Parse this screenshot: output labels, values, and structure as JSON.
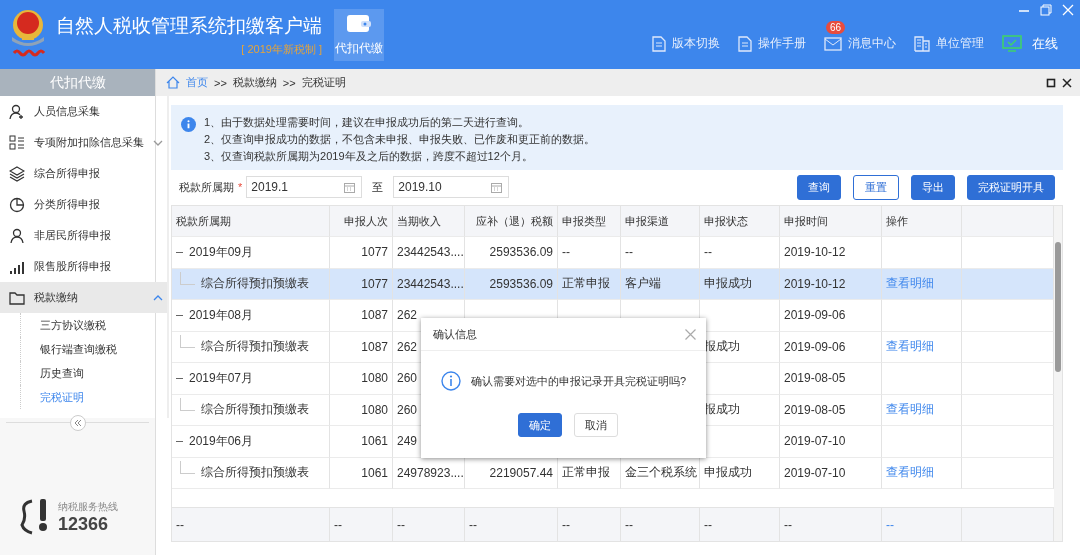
{
  "header": {
    "title": "自然人税收管理系统扣缴客户端",
    "subtitle": "[ 2019年新税制 ]",
    "module": {
      "label": "代扣代缴",
      "selected": true
    },
    "nav": [
      {
        "kind": "doc",
        "label": "版本切换"
      },
      {
        "kind": "doc",
        "label": "操作手册"
      },
      {
        "kind": "mail",
        "label": "消息中心",
        "badge": "66"
      },
      {
        "kind": "building",
        "label": "单位管理"
      },
      {
        "kind": "online",
        "label": "在线"
      }
    ]
  },
  "sidebar": {
    "title": "代扣代缴",
    "items": [
      {
        "kind": "person-plus",
        "label": "人员信息采集",
        "selected": false
      },
      {
        "kind": "list",
        "label": "专项附加扣除信息采集",
        "selected": false,
        "expanded": false
      },
      {
        "kind": "layers",
        "label": "综合所得申报",
        "selected": false
      },
      {
        "kind": "pie",
        "label": "分类所得申报",
        "selected": false
      },
      {
        "kind": "person",
        "label": "非居民所得申报",
        "selected": false
      },
      {
        "kind": "bars",
        "label": "限售股所得申报",
        "selected": false
      },
      {
        "kind": "folder",
        "label": "税款缴纳",
        "selected": true,
        "expanded": true,
        "children": [
          {
            "label": "三方协议缴税",
            "selected": false
          },
          {
            "label": "银行端查询缴税",
            "selected": false
          },
          {
            "label": "历史查询",
            "selected": false
          },
          {
            "label": "完税证明",
            "selected": true
          }
        ]
      }
    ],
    "hotline": {
      "label": "纳税服务热线",
      "number": "12366"
    }
  },
  "breadcrumb": [
    "首页",
    ">>",
    "税款缴纳",
    ">>",
    "完税证明"
  ],
  "notice": [
    "1、由于数据处理需要时间，建议在申报成功后的第二天进行查询。",
    "2、仅查询申报成功的数据，不包含未申报、申报失败、已作废和更正前的数据。",
    "3、仅查询税款所属期为2019年及之后的数据，跨度不超过12个月。"
  ],
  "filter": {
    "label": "税款所属期",
    "required_mark": "*",
    "from": "2019.1",
    "to_label": "至",
    "to": "2019.10"
  },
  "buttons": [
    {
      "kind": "primary",
      "label": "查询"
    },
    {
      "kind": "outline",
      "label": "重置"
    },
    {
      "kind": "primary",
      "label": "导出"
    },
    {
      "kind": "primary",
      "label": "完税证明开具"
    }
  ],
  "table": {
    "columns": [
      "税款所属期",
      "申报人次",
      "当期收入",
      "应补（退）税额",
      "申报类型",
      "申报渠道",
      "申报状态",
      "申报时间",
      "操作"
    ],
    "groups": [
      {
        "period": "2019年09月",
        "count": "1077",
        "income": "23442543....",
        "tax": "2593536.09",
        "type": "--",
        "channel": "--",
        "status": "--",
        "time": "2019-10-12",
        "expanded": true,
        "children": [
          {
            "period": "综合所得预扣预缴表",
            "count": "1077",
            "income": "23442543....",
            "tax": "2593536.09",
            "type": "正常申报",
            "channel": "客户端",
            "status": "申报成功",
            "time": "2019-10-12",
            "action": "查看明细",
            "selected": true
          }
        ]
      },
      {
        "period": "2019年08月",
        "count": "1087",
        "income": "262",
        "time": "2019-09-06",
        "expanded": true,
        "children": [
          {
            "period": "综合所得预扣预缴表",
            "count": "1087",
            "income": "262",
            "status": "报成功",
            "time": "2019-09-06",
            "action": "查看明细",
            "selected": false
          }
        ]
      },
      {
        "period": "2019年07月",
        "count": "1080",
        "income": "260",
        "time": "2019-08-05",
        "expanded": true,
        "children": [
          {
            "period": "综合所得预扣预缴表",
            "count": "1080",
            "income": "260",
            "status": "报成功",
            "time": "2019-08-05",
            "action": "查看明细",
            "selected": false
          }
        ]
      },
      {
        "period": "2019年06月",
        "count": "1061",
        "income": "249",
        "time": "2019-07-10",
        "expanded": true,
        "children": [
          {
            "period": "综合所得预扣预缴表",
            "count": "1061",
            "income": "24978923....",
            "tax": "2219057.44",
            "type": "正常申报",
            "channel": "金三个税系统",
            "status": "申报成功",
            "time": "2019-07-10",
            "action": "查看明细",
            "selected": false
          }
        ]
      }
    ],
    "footer": [
      "--",
      "--",
      "--",
      "--",
      "--",
      "--",
      "--",
      "--",
      "--"
    ]
  },
  "dialog": {
    "title": "确认信息",
    "message": "确认需要对选中的申报记录开具完税证明吗?",
    "buttons": [
      {
        "kind": "primary",
        "label": "确定"
      },
      {
        "kind": "default",
        "label": "取消"
      }
    ]
  }
}
